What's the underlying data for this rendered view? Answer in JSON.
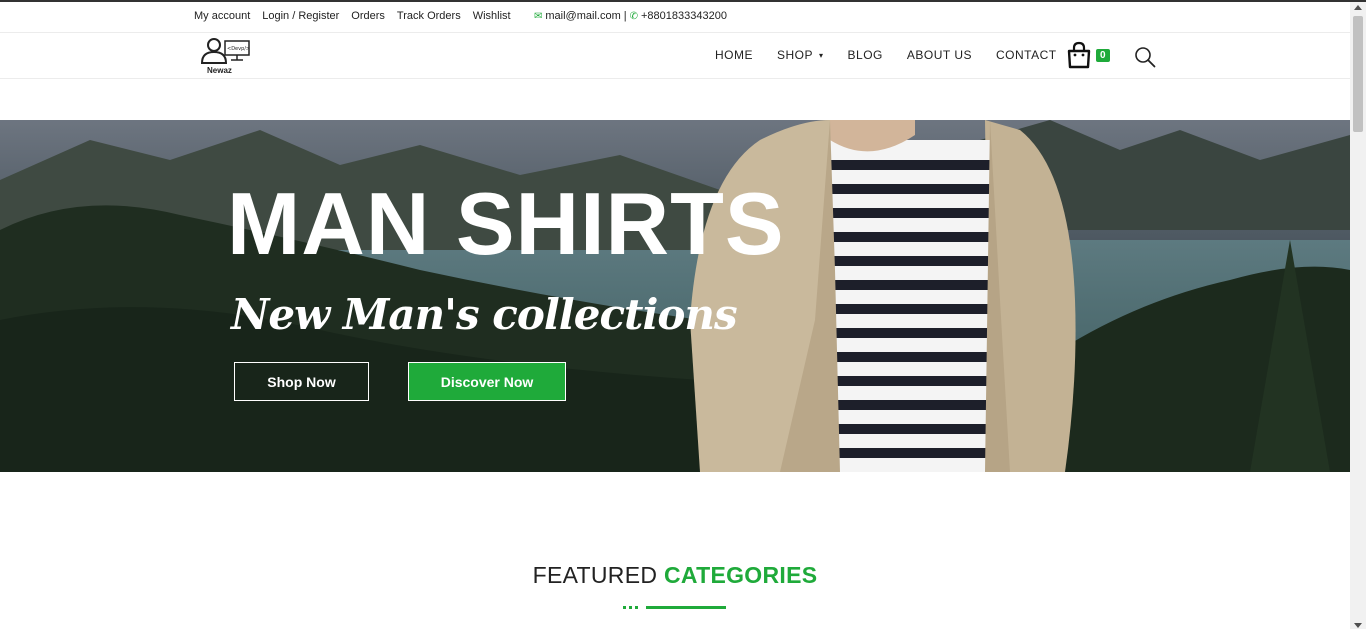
{
  "topbar": {
    "links": [
      "My account",
      "Login / Register",
      "Orders",
      "Track Orders",
      "Wishlist"
    ],
    "email": "mail@mail.com",
    "separator": "|",
    "phone": "+8801833343200"
  },
  "logo": {
    "text": "Newaz",
    "badge": "<Devp/>"
  },
  "nav": {
    "items": [
      "HOME",
      "SHOP",
      "BLOG",
      "ABOUT US",
      "CONTACT"
    ],
    "cart_count": "0"
  },
  "hero": {
    "title": "MAN SHIRTS",
    "subtitle": "New Man's collections",
    "shop_label": "Shop Now",
    "discover_label": "Discover Now"
  },
  "featured": {
    "prefix": "FEATURED",
    "highlight": "CATEGORIES"
  },
  "colors": {
    "accent": "#1faa3a",
    "text": "#222222"
  },
  "icons": [
    "email-icon",
    "phone-icon",
    "cart-icon",
    "search-icon",
    "chevron-down-icon"
  ]
}
